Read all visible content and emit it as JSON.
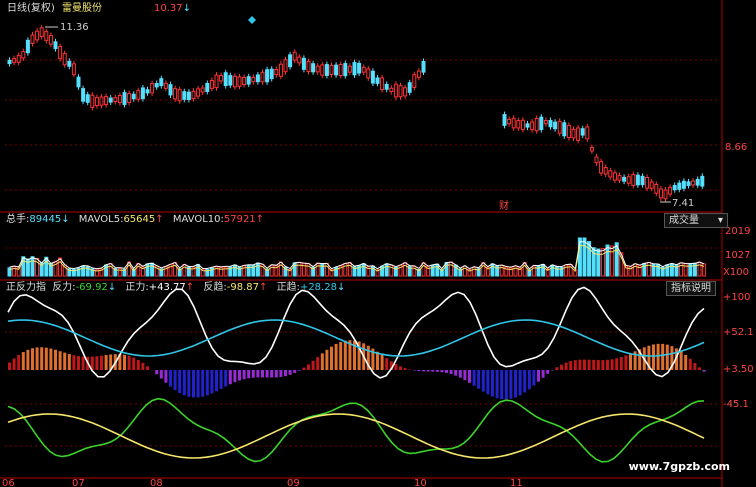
{
  "header": {
    "chart_title": "日线(复权)",
    "stock_name": "雷曼股份",
    "price_top": "10.37"
  },
  "price_panel": {
    "label_high": "11.36",
    "label_low": "7.41",
    "label_axis": "8.66",
    "label_fin": "财"
  },
  "volume_panel": {
    "total_label": "总手:",
    "total_value": "89445",
    "mavol5_label": "MAVOL5:",
    "mavol5_value": "65645",
    "mavol10_label": "MAVOL10:",
    "mavol10_value": "57921",
    "dropdown_label": "成交量",
    "axis_top": "2019",
    "axis_mid": "1027",
    "axis_bot": "X100"
  },
  "indicator_panel": {
    "title": "正反力指",
    "fanli_label": "反力:",
    "fanli_value": "-69.92",
    "zhengli_label": "正力:",
    "zhengli_value": "+43.77",
    "fanqu_label": "反趋:",
    "fanqu_value": "-98.87",
    "zhengqu_label": "正趋:",
    "zhengqu_value": "+28.28",
    "help_button": "指标说明",
    "axis_labels": [
      "+100",
      "+52.1",
      "+3.50",
      "-45.1"
    ]
  },
  "x_axis": [
    "06",
    "07",
    "08",
    "09",
    "10",
    "11"
  ],
  "watermark": "www.7gpzb.com",
  "colors": {
    "up": "#ff3333",
    "down": "#54e0ff",
    "white_line": "#ffffff",
    "cyan_line": "#2fc6e8",
    "yellow_line": "#f5e56a",
    "green_line": "#3ad42a",
    "grid": "#7a0000"
  }
}
